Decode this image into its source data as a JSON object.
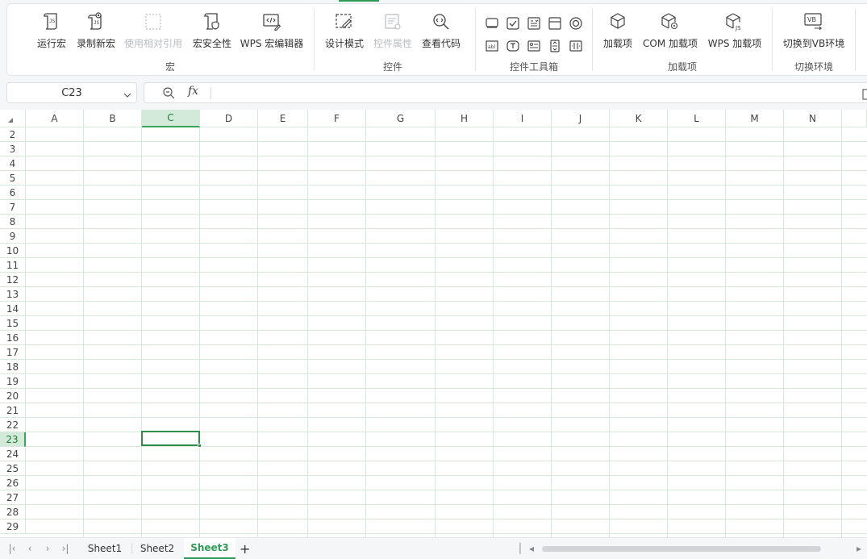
{
  "ribbon": {
    "macro_group": {
      "label": "宏",
      "buttons": [
        {
          "label": "运行宏",
          "icon": "run-macro-icon",
          "enabled": true
        },
        {
          "label": "录制新宏",
          "icon": "record-macro-icon",
          "enabled": true
        },
        {
          "label": "使用相对引用",
          "icon": "relative-reference-icon",
          "enabled": false
        },
        {
          "label": "宏安全性",
          "icon": "macro-security-icon",
          "enabled": true
        },
        {
          "label": "WPS 宏编辑器",
          "icon": "macro-editor-icon",
          "enabled": true
        }
      ]
    },
    "controls_group": {
      "label": "控件",
      "buttons": [
        {
          "label": "设计模式",
          "icon": "design-mode-icon",
          "enabled": true
        },
        {
          "label": "控件属性",
          "icon": "control-properties-icon",
          "enabled": false
        },
        {
          "label": "查看代码",
          "icon": "view-code-icon",
          "enabled": true
        }
      ]
    },
    "toolbox_group": {
      "label": "控件工具箱",
      "icons": [
        "command-button-icon",
        "checkbox-icon",
        "listbox-icon",
        "frame-icon",
        "option-button-icon",
        "textbox-icon",
        "label-icon",
        "combobox-icon",
        "spin-button-icon",
        "scrollbar-icon"
      ]
    },
    "addins_group": {
      "label": "加载项",
      "buttons": [
        {
          "label": "加载项",
          "icon": "addin-icon",
          "enabled": true
        },
        {
          "label": "COM 加载项",
          "icon": "com-addin-icon",
          "enabled": true
        },
        {
          "label": "WPS 加载项",
          "icon": "wps-addin-icon",
          "enabled": true
        }
      ]
    },
    "vb_group": {
      "label": "切换环境",
      "buttons": [
        {
          "label": "切换到VB环境",
          "icon": "switch-vb-icon",
          "enabled": true
        }
      ]
    }
  },
  "formula_bar": {
    "name_box": "C23",
    "fx_label": "fx",
    "formula": ""
  },
  "grid": {
    "columns": [
      "A",
      "B",
      "C",
      "D",
      "E",
      "F",
      "G",
      "H",
      "I",
      "J",
      "K",
      "L",
      "M",
      "N"
    ],
    "rows": [
      "2",
      "3",
      "4",
      "5",
      "6",
      "7",
      "8",
      "9",
      "10",
      "11",
      "12",
      "13",
      "14",
      "15",
      "16",
      "17",
      "18",
      "19",
      "20",
      "21",
      "22",
      "23",
      "24",
      "25",
      "26",
      "27",
      "28",
      "29"
    ],
    "selected_column": "C",
    "selected_row": "23"
  },
  "sheets": {
    "tabs": [
      "Sheet1",
      "Sheet2",
      "Sheet3"
    ],
    "active": "Sheet3",
    "add_label": "+"
  },
  "colors": {
    "accent": "#2e9a55",
    "grid_line": "#d6e8db",
    "selection_header": "#d4ead9"
  }
}
